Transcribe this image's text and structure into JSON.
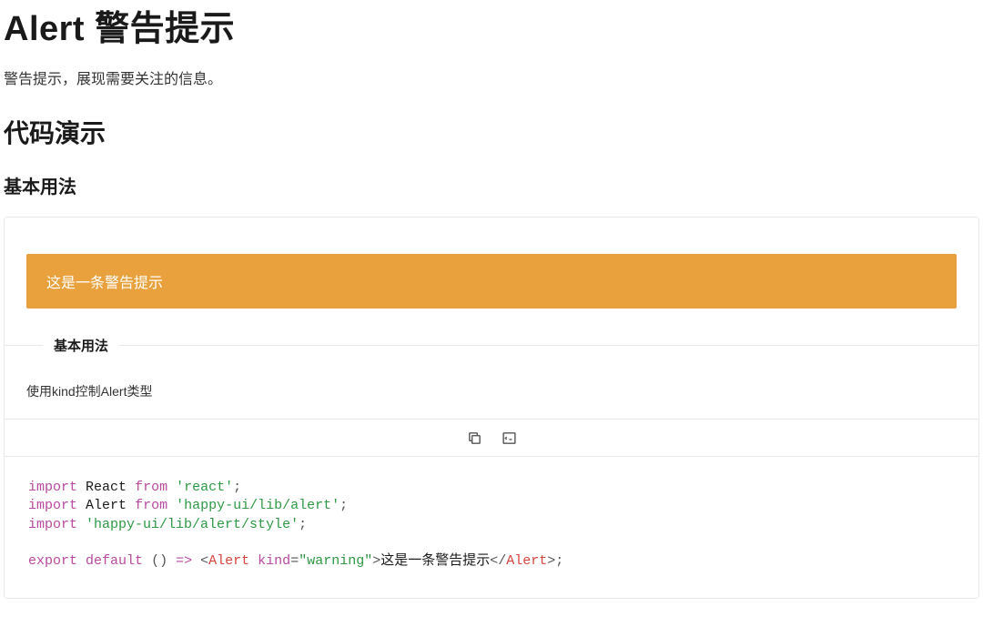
{
  "page": {
    "title": "Alert 警告提示",
    "subtitle": "警告提示，展现需要关注的信息。",
    "codeDemoHeading": "代码演示",
    "basicUsageHeading": "基本用法"
  },
  "demo": {
    "alertText": "这是一条警告提示",
    "metaTitle": "基本用法",
    "metaDesc": "使用kind控制Alert类型",
    "code": {
      "line1": {
        "kw1": "import",
        "id": "React",
        "kw2": "from",
        "str": "'react'",
        "end": ";"
      },
      "line2": {
        "kw1": "import",
        "id": "Alert",
        "kw2": "from",
        "str": "'happy-ui/lib/alert'",
        "end": ";"
      },
      "line3": {
        "kw1": "import",
        "str": "'happy-ui/lib/alert/style'",
        "end": ";"
      },
      "line5": {
        "kw1": "export",
        "kw2": "default",
        "paren": "()",
        "arrow": "=>",
        "open1": "<",
        "tag1": "Alert",
        "attr": "kind",
        "eq": "=",
        "val": "\"warning\"",
        "close1": ">",
        "inner": "这是一条警告提示",
        "open2": "</",
        "tag2": "Alert",
        "close2": ">",
        "end": ";"
      }
    }
  }
}
